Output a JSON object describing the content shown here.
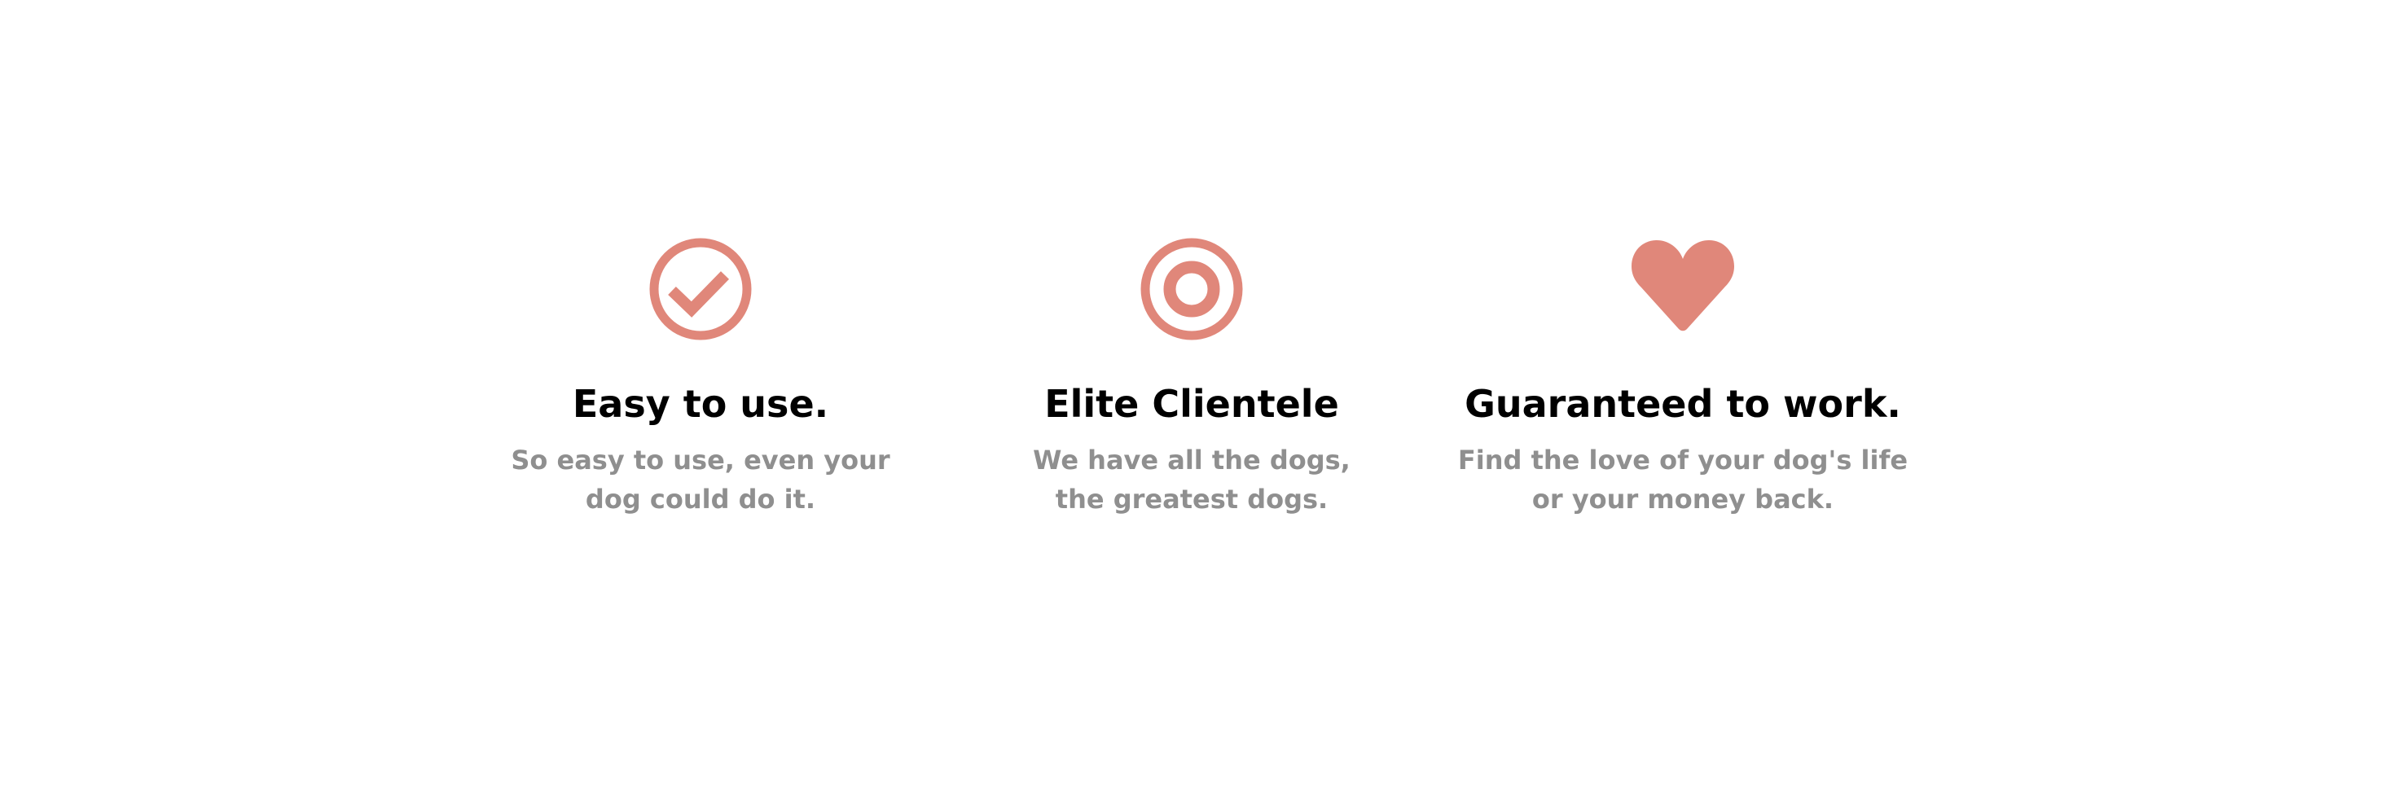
{
  "accent_color": "#e0877a",
  "features": [
    {
      "icon": "check-circle-icon",
      "title": "Easy to use.",
      "description": "So easy to use, even your dog could do it."
    },
    {
      "icon": "target-icon",
      "title": "Elite Clientele",
      "description": "We have all the dogs, the greatest dogs."
    },
    {
      "icon": "heart-icon",
      "title": "Guaranteed to work.",
      "description": "Find the love of your dog's life or your money back."
    }
  ]
}
